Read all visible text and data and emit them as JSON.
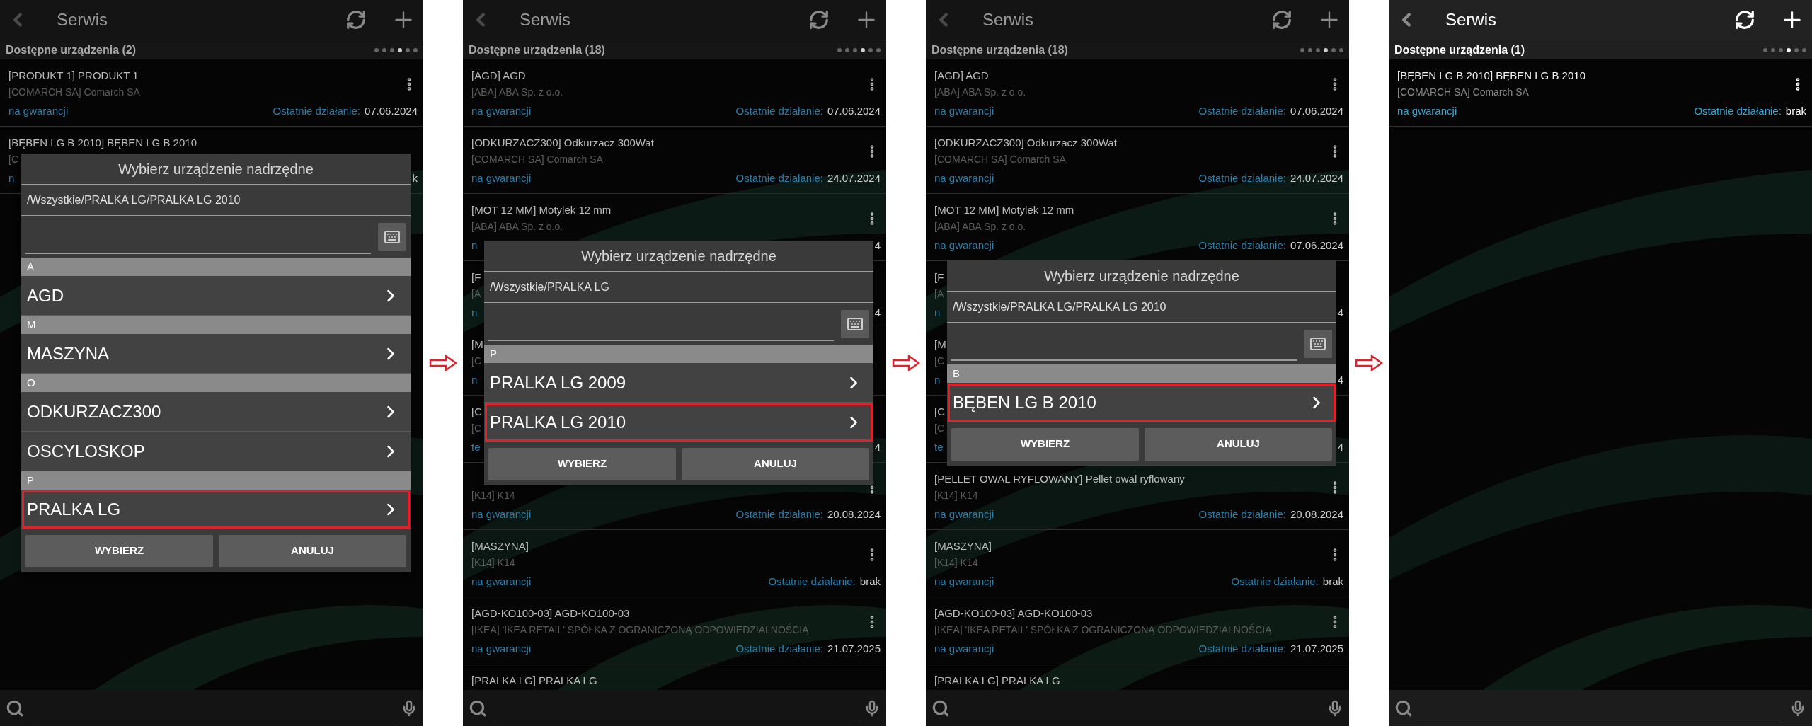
{
  "panels": [
    {
      "header": {
        "title": "Serwis"
      },
      "section": {
        "label": "Dostępne urządzenia (2)"
      },
      "page_dots": [
        {
          "selected": false
        },
        {
          "selected": false
        },
        {
          "selected": false
        },
        {
          "selected": true
        },
        {
          "selected": false
        },
        {
          "selected": false
        }
      ],
      "items": [
        {
          "title": "[PRODUKT 1] PRODUKT 1",
          "subtitle": "[COMARCH SA] Comarch SA",
          "status": "na gwarancji",
          "label": "Ostatnie działanie:",
          "value": "07.06.2024",
          "menu": true
        },
        {
          "title": "[BĘBEN LG B 2010] BĘBEN LG B 2010",
          "subtitle": "[C",
          "status": "n",
          "value": "k",
          "menu": false
        }
      ],
      "dialog": {
        "title": "Wybierz urządzenie nadrzędne",
        "path": "/Wszystkie/PRALKA LG/PRALKA LG 2010",
        "groups": [
          {
            "letter": "A",
            "items": [
              {
                "label": "AGD",
                "selected": false
              }
            ]
          },
          {
            "letter": "M",
            "items": [
              {
                "label": "MASZYNA",
                "selected": false
              }
            ]
          },
          {
            "letter": "O",
            "items": [
              {
                "label": "ODKURZACZ300",
                "selected": false
              },
              {
                "label": "OSCYLOSKOP",
                "selected": false
              }
            ]
          },
          {
            "letter": "P",
            "items": [
              {
                "label": "PRALKA LG",
                "selected": true
              }
            ]
          }
        ],
        "buttons": [
          "WYBIERZ",
          "ANULUJ"
        ]
      }
    },
    {
      "header": {
        "title": "Serwis"
      },
      "section": {
        "label": "Dostępne urządzenia (18)"
      },
      "page_dots": [
        {
          "selected": false
        },
        {
          "selected": false
        },
        {
          "selected": false
        },
        {
          "selected": true
        },
        {
          "selected": false
        },
        {
          "selected": false
        }
      ],
      "items": [
        {
          "title": "[AGD] AGD",
          "subtitle": "[ABA] ABA Sp. z o.o.",
          "status": "na gwarancji",
          "label": "Ostatnie działanie:",
          "value": "07.06.2024",
          "menu": true
        },
        {
          "title": "[ODKURZACZ300] Odkurzacz 300Wat",
          "subtitle": "[COMARCH SA] Comarch SA",
          "status": "na gwarancji",
          "label": "Ostatnie działanie:",
          "value": "24.07.2024",
          "menu": true
        },
        {
          "title": "[MOT 12 MM] Motylek 12 mm",
          "subtitle": "[ABA] ABA Sp. z o.o.",
          "status": "n",
          "value": "4",
          "menu": true
        },
        {
          "title": "[F",
          "subtitle": "[A",
          "status": "n",
          "value": "4",
          "menu": false
        },
        {
          "title": "[M",
          "subtitle": "[C",
          "status": "n",
          "menu": false
        },
        {
          "title": "[C",
          "subtitle": "[C",
          "status": "te",
          "value": "4",
          "menu": false
        },
        {
          "subtitle": "[K14] K14",
          "status": "na gwarancji",
          "label": "Ostatnie działanie:",
          "value": "20.08.2024",
          "menu": true
        },
        {
          "title": "[MASZYNA]",
          "subtitle": "[K14] K14",
          "status": "na gwarancji",
          "label": "Ostatnie działanie:",
          "value": "brak",
          "menu": true
        },
        {
          "title": "[AGD-KO100-03] AGD-KO100-03",
          "subtitle": "[IKEA] 'IKEA RETAIL' SPÓŁKA Z OGRANICZONĄ ODPOWIEDZIALNOŚCIĄ",
          "status": "na gwarancji",
          "label": "Ostatnie działanie:",
          "value": "21.07.2025",
          "menu": true
        },
        {
          "title": "[PRALKA LG] PRALKA LG",
          "menu": false
        }
      ],
      "dialog": {
        "title": "Wybierz urządzenie nadrzędne",
        "path": "/Wszystkie/PRALKA LG",
        "groups": [
          {
            "letter": "P",
            "items": [
              {
                "label": "PRALKA LG 2009",
                "selected": false
              },
              {
                "label": "PRALKA LG 2010",
                "selected": true
              }
            ]
          }
        ],
        "buttons": [
          "WYBIERZ",
          "ANULUJ"
        ]
      }
    },
    {
      "header": {
        "title": "Serwis"
      },
      "section": {
        "label": "Dostępne urządzenia (18)"
      },
      "page_dots": [
        {
          "selected": false
        },
        {
          "selected": false
        },
        {
          "selected": false
        },
        {
          "selected": true
        },
        {
          "selected": false
        },
        {
          "selected": false
        }
      ],
      "items": [
        {
          "title": "[AGD] AGD",
          "subtitle": "[ABA] ABA Sp. z o.o.",
          "status": "na gwarancji",
          "label": "Ostatnie działanie:",
          "value": "07.06.2024",
          "menu": true
        },
        {
          "title": "[ODKURZACZ300] Odkurzacz 300Wat",
          "subtitle": "[COMARCH SA] Comarch SA",
          "status": "na gwarancji",
          "label": "Ostatnie działanie:",
          "value": "24.07.2024",
          "menu": true
        },
        {
          "title": "[MOT 12 MM] Motylek 12 mm",
          "subtitle": "[ABA] ABA Sp. z o.o.",
          "status": "na gwarancji",
          "label": "Ostatnie działanie:",
          "value": "07.06.2024",
          "menu": true
        },
        {
          "title": "[F",
          "subtitle": "[A",
          "status": "n",
          "value": "4",
          "menu": false
        },
        {
          "title": "[M",
          "subtitle": "[C",
          "status": "n",
          "value": "4",
          "menu": false
        },
        {
          "title": "[C",
          "subtitle": "[C",
          "status": "te",
          "value": "4",
          "menu": false
        },
        {
          "title": "[PELLET OWAL RYFLOWANY] Pellet owal ryflowany",
          "subtitle": "[K14] K14",
          "status": "na gwarancji",
          "label": "Ostatnie działanie:",
          "value": "20.08.2024",
          "menu": true
        },
        {
          "title": "[MASZYNA]",
          "subtitle": "[K14] K14",
          "status": "na gwarancji",
          "label": "Ostatnie działanie:",
          "value": "brak",
          "menu": true
        },
        {
          "title": "[AGD-KO100-03] AGD-KO100-03",
          "subtitle": "[IKEA] 'IKEA RETAIL' SPÓŁKA Z OGRANICZONĄ ODPOWIEDZIALNOŚCIĄ",
          "status": "na gwarancji",
          "label": "Ostatnie działanie:",
          "value": "21.07.2025",
          "menu": true
        },
        {
          "title": "[PRALKA LG] PRALKA LG",
          "menu": false
        }
      ],
      "dialog": {
        "title": "Wybierz urządzenie nadrzędne",
        "path": "/Wszystkie/PRALKA LG/PRALKA LG 2010",
        "groups": [
          {
            "letter": "B",
            "items": [
              {
                "label": "BĘBEN LG B 2010",
                "selected": true
              }
            ]
          }
        ],
        "buttons": [
          "WYBIERZ",
          "ANULUJ"
        ]
      }
    },
    {
      "header": {
        "title": "Serwis"
      },
      "section": {
        "label": "Dostępne urządzenia (1)"
      },
      "page_dots": [
        {
          "selected": false
        },
        {
          "selected": false
        },
        {
          "selected": false
        },
        {
          "selected": true
        },
        {
          "selected": false
        },
        {
          "selected": false
        }
      ],
      "items": [
        {
          "title": "[BĘBEN LG B 2010] BĘBEN LG B 2010",
          "subtitle": "[COMARCH SA] Comarch SA",
          "status": "na gwarancji",
          "label": "Ostatnie działanie:",
          "value": "brak",
          "menu": true
        }
      ]
    }
  ]
}
